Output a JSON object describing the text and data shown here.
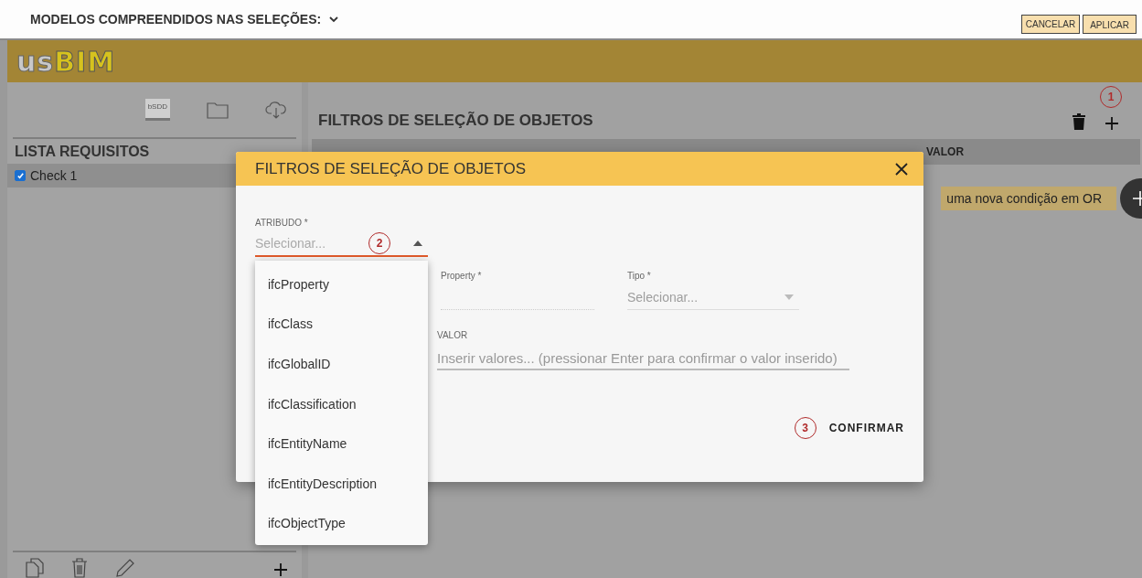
{
  "top_bar": {
    "models_label": "MODELOS COMPREENDIDOS NAS SELEÇÕES:",
    "buttons": [
      "CANCELAR",
      "APLICAR"
    ]
  },
  "header": {
    "logo_part1": "us",
    "logo_part2": "BIM"
  },
  "sidebar": {
    "toolbar_badge": "bSDD",
    "title": "LISTA REQUISITOS",
    "items": [
      {
        "label": "Check 1",
        "checked": true
      }
    ]
  },
  "main": {
    "title": "FILTROS DE SELEÇÃO DE OBJETOS",
    "add_marker": "1",
    "table": {
      "columns": [
        "VALOR"
      ]
    },
    "or_hint": "uma nova condição em OR"
  },
  "dialog": {
    "title": "FILTROS DE SELEÇÃO DE OBJETOS",
    "atributo": {
      "label": "ATRIBUDO *",
      "placeholder": "Selecionar...",
      "marker": "2",
      "expanded": true,
      "options": [
        "ifcProperty",
        "ifcClass",
        "ifcGlobalID",
        "ifcClassification",
        "ifcEntityName",
        "ifcEntityDescription",
        "ifcObjectType"
      ]
    },
    "property": {
      "label": "Property *",
      "disabled": true
    },
    "tipo": {
      "label": "Tipo *",
      "placeholder": "Selecionar...",
      "disabled": true
    },
    "valor": {
      "label": "VALOR",
      "placeholder": "Inserir valores... (pressionar Enter para confirmar o valor inserido)"
    },
    "confirm_marker": "3",
    "confirm": "CONFIRMAR"
  }
}
